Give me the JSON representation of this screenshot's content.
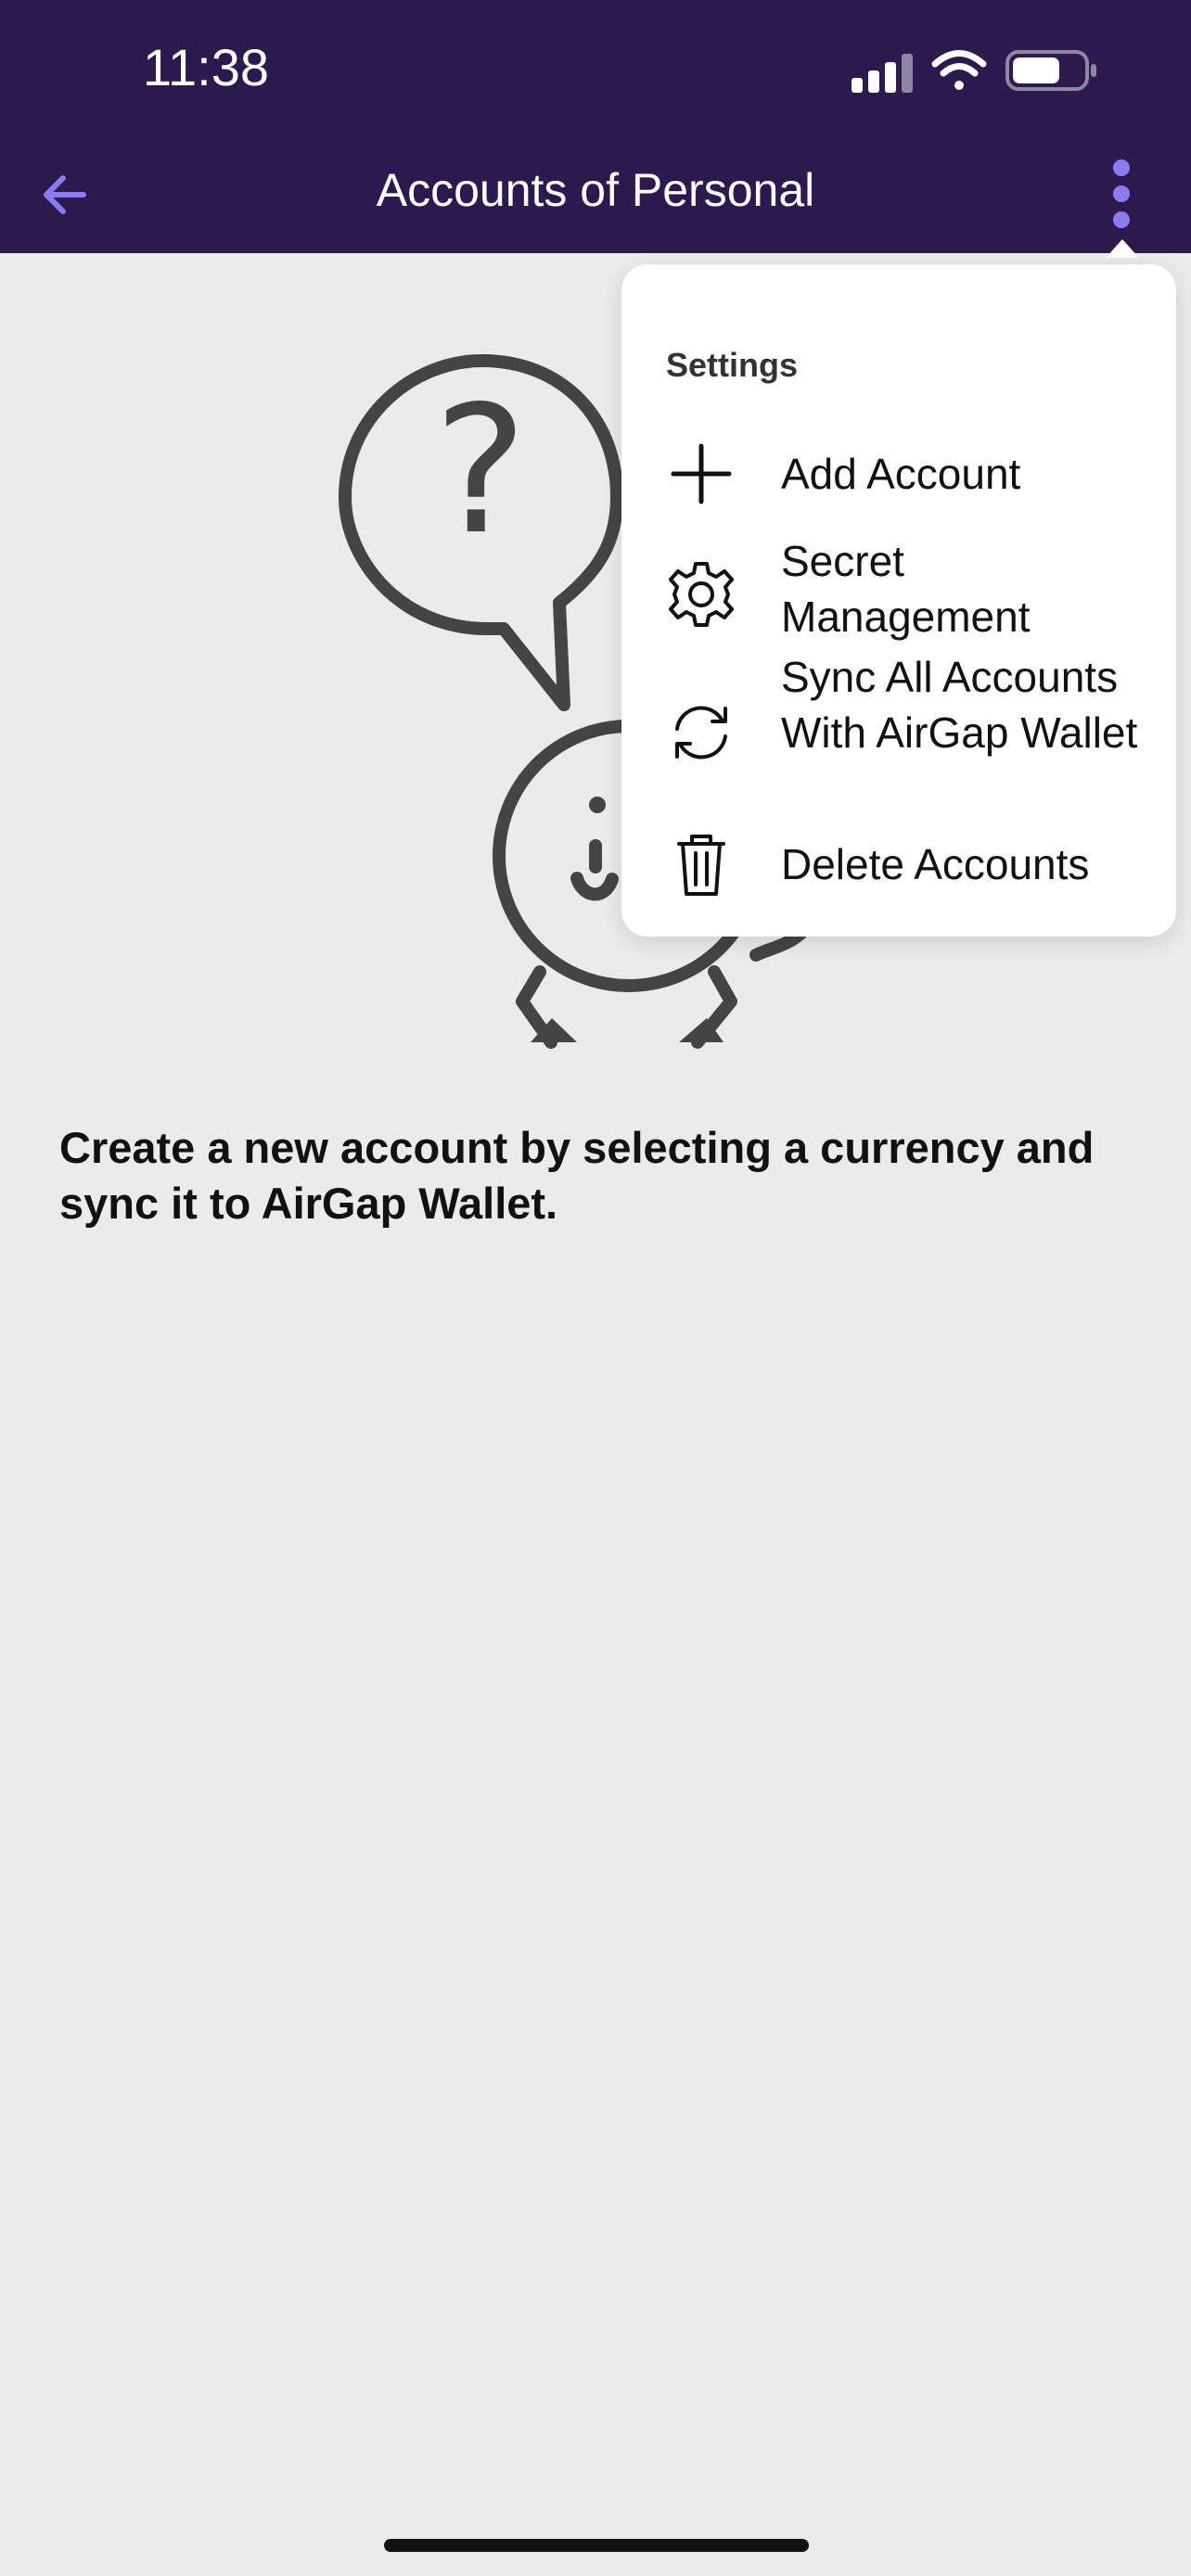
{
  "status_bar": {
    "time": "11:38",
    "icons": [
      "cellular-signal-icon",
      "wifi-icon",
      "battery-icon"
    ]
  },
  "header": {
    "title": "Accounts of Personal",
    "back_icon": "arrow-left-icon",
    "more_icon": "more-vertical-icon",
    "accent_color": "#8b7bf0",
    "background_color": "#2c1a4f"
  },
  "empty_state": {
    "illustration": "confused-character-question-illustration",
    "message": "Create a new account by selecting a currency and sync it to AirGap Wallet."
  },
  "popover": {
    "header": "Settings",
    "items": [
      {
        "label": "Add Account",
        "icon": "plus-icon"
      },
      {
        "label": "Secret Management",
        "icon": "gear-icon"
      },
      {
        "label": "Sync All Accounts With AirGap Wallet",
        "icon": "sync-icon"
      },
      {
        "label": "Delete Accounts",
        "icon": "trash-icon"
      }
    ]
  }
}
